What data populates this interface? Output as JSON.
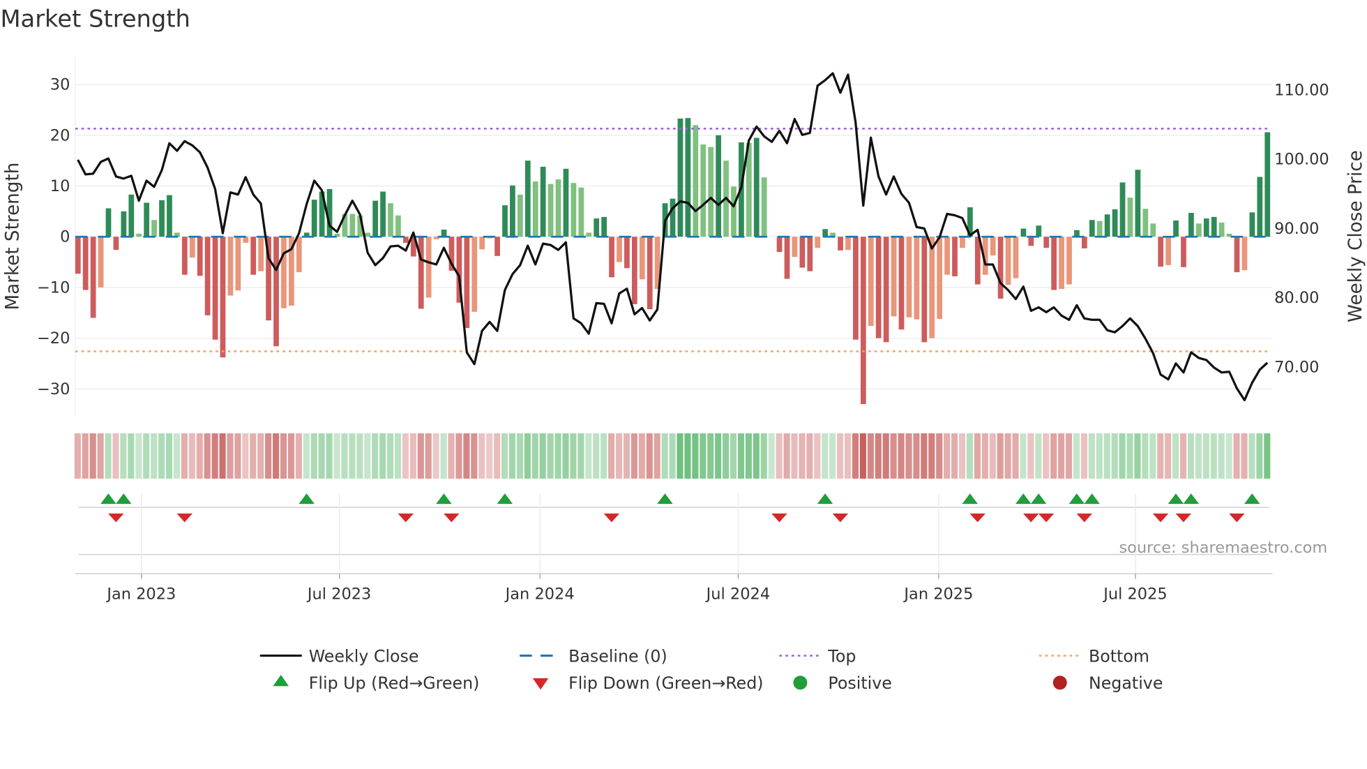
{
  "chart_data": {
    "type": "bar",
    "title": "Market Strength",
    "ylabel": "Market Strength",
    "y2label": "Weekly Close Price",
    "ylim": [
      -35.5,
      35.5
    ],
    "y2lim": [
      62.8,
      114.8
    ],
    "grid": true,
    "legend_placement": "bottom",
    "source": "source: sharemaestro.com",
    "y_ticks": [
      {
        "v": 30,
        "label": "30"
      },
      {
        "v": 20,
        "label": "20"
      },
      {
        "v": 10,
        "label": "10"
      },
      {
        "v": 0,
        "label": "0"
      },
      {
        "v": -10,
        "label": "−10"
      },
      {
        "v": -20,
        "label": "−20"
      },
      {
        "v": -30,
        "label": "−30"
      }
    ],
    "y2_ticks": [
      {
        "v": 110,
        "label": "110.00"
      },
      {
        "v": 100,
        "label": "100.00"
      },
      {
        "v": 90,
        "label": "90.00"
      },
      {
        "v": 80,
        "label": "80.00"
      },
      {
        "v": 70,
        "label": "70.00"
      }
    ],
    "x_ticks": [
      {
        "week": 8.34,
        "label": "Jan 2023"
      },
      {
        "week": 34.3,
        "label": "Jul 2023"
      },
      {
        "week": 60.6,
        "label": "Jan 2024"
      },
      {
        "week": 86.6,
        "label": "Jul 2024"
      },
      {
        "week": 112.9,
        "label": "Jan 2025"
      },
      {
        "week": 138.7,
        "label": "Jul 2025"
      }
    ],
    "top_level": 21.3,
    "bottom_level": -22.6,
    "strength": [
      -7.3,
      -10.5,
      -16,
      -10,
      5.6,
      -2.6,
      5,
      8.3,
      0.6,
      6.7,
      3.3,
      7.2,
      8.2,
      0.8,
      -7.5,
      -4.1,
      -7.7,
      -15.5,
      -20.3,
      -23.8,
      -11.6,
      -10.6,
      -1.2,
      -7.5,
      -6.8,
      -16.5,
      -21.6,
      -14.1,
      -13.6,
      -7,
      0.8,
      7.3,
      8.9,
      9.4,
      0.6,
      4.5,
      4.5,
      4.2,
      0.8,
      7.1,
      8.9,
      6.6,
      4.2,
      -1.2,
      -3.9,
      -14.2,
      -12,
      -0.5,
      1.4,
      -6.7,
      -13,
      -18,
      -14.8,
      -2.5,
      -0.3,
      -3.8,
      6.2,
      10.1,
      8.3,
      15,
      10.9,
      13.8,
      10.4,
      11.3,
      13.4,
      10.6,
      9.7,
      0.8,
      3.6,
      3.9,
      -8,
      -5,
      -6.2,
      -13.3,
      -8.4,
      -14.3,
      -10.3,
      6.6,
      7.5,
      23.3,
      23.4,
      22,
      18.2,
      17.7,
      20,
      15,
      9.9,
      18.6,
      18.5,
      19.5,
      11.7,
      0,
      -3,
      -8.3,
      -4,
      -6.1,
      -6.8,
      -2.2,
      1.5,
      0.8,
      -2.7,
      -2.6,
      -20.3,
      -33,
      -17.6,
      -20,
      -20.8,
      -15.7,
      -18.3,
      -15.9,
      -16.3,
      -20.8,
      -20,
      -16.2,
      -7.5,
      -7.8,
      -2.2,
      5.8,
      -9.4,
      -7.5,
      -3.7,
      -12.2,
      -9.5,
      -8.2,
      1.6,
      -1.8,
      2.2,
      -2.2,
      -10.5,
      -10.3,
      -9.4,
      1.3,
      -2.3,
      3.3,
      3.1,
      4.4,
      5.4,
      10.7,
      7.7,
      13.2,
      5.5,
      2.6,
      -5.9,
      -5.6,
      3.2,
      -6,
      4.7,
      2.6,
      3.6,
      3.9,
      2.8,
      0.6,
      -7,
      -6.6,
      4.8,
      11.8,
      20.6
    ],
    "strong": [
      1,
      1,
      1,
      0,
      1,
      1,
      1,
      1,
      0,
      1,
      0,
      1,
      1,
      0,
      1,
      0,
      1,
      1,
      1,
      1,
      0,
      0,
      0,
      1,
      0,
      1,
      1,
      0,
      0,
      0,
      1,
      1,
      1,
      1,
      0,
      0,
      0,
      0,
      0,
      1,
      1,
      0,
      0,
      1,
      1,
      1,
      0,
      0,
      1,
      1,
      1,
      1,
      0,
      0,
      0,
      1,
      1,
      1,
      0,
      1,
      0,
      1,
      0,
      0,
      1,
      0,
      0,
      0,
      1,
      1,
      1,
      0,
      1,
      1,
      0,
      1,
      0,
      1,
      1,
      1,
      1,
      0,
      0,
      0,
      1,
      0,
      0,
      1,
      0,
      1,
      0,
      0,
      1,
      1,
      0,
      1,
      1,
      0,
      1,
      0,
      1,
      0,
      1,
      1,
      0,
      1,
      1,
      0,
      1,
      0,
      0,
      1,
      0,
      0,
      0,
      1,
      0,
      1,
      1,
      0,
      0,
      1,
      0,
      0,
      1,
      1,
      1,
      1,
      1,
      0,
      0,
      1,
      1,
      1,
      0,
      1,
      1,
      1,
      0,
      1,
      0,
      0,
      1,
      0,
      1,
      1,
      1,
      0,
      1,
      1,
      0,
      0,
      1,
      0,
      1,
      1,
      1
    ],
    "weekly_close": [
      99.9,
      97.8,
      97.9,
      99.6,
      100.1,
      97.5,
      97.2,
      97.6,
      94,
      96.9,
      96,
      98.4,
      102.3,
      101.2,
      102.6,
      102,
      101,
      98.8,
      95.7,
      89.3,
      95.2,
      94.9,
      97.4,
      94.9,
      93.6,
      85.7,
      84,
      86.4,
      87,
      89.3,
      93.5,
      96.9,
      95.5,
      90.4,
      89.5,
      91.9,
      94,
      92,
      86.5,
      84.7,
      85.7,
      87.4,
      87.5,
      86.8,
      89.4,
      85.5,
      85.1,
      84.8,
      87.2,
      84.9,
      83.1,
      72.1,
      70.4,
      75.2,
      76.5,
      75.2,
      81.1,
      83.4,
      84.7,
      87.5,
      84.8,
      87.8,
      87.6,
      86.9,
      88,
      77,
      76.3,
      74.8,
      79.2,
      79.1,
      76.3,
      80.6,
      81.3,
      77.6,
      78.5,
      76.7,
      78.3,
      91.1,
      92.9,
      93.9,
      93.7,
      92.5,
      93.4,
      94.4,
      93.4,
      94.4,
      93.2,
      95.9,
      102.7,
      104.7,
      103.3,
      102.5,
      104.1,
      102.3,
      105.8,
      103.5,
      103.8,
      110.6,
      111.4,
      112.4,
      109.6,
      112.2,
      105.3,
      93.3,
      103.1,
      97.5,
      94.9,
      97.5,
      95,
      93.7,
      90.2,
      90,
      87.1,
      88.7,
      92.1,
      91.9,
      91.5,
      89,
      89.8,
      84.8,
      84.8,
      82.1,
      81.1,
      79.8,
      81.6,
      78.1,
      78.6,
      77.9,
      78.6,
      77.4,
      76.8,
      78.9,
      77,
      76.8,
      76.8,
      75.3,
      75,
      75.9,
      77,
      75.9,
      74.1,
      72,
      68.9,
      68.2,
      70.5,
      69.2,
      72.1,
      71.3,
      71,
      69.9,
      69.2,
      69.3,
      66.9,
      65.2,
      67.7,
      69.6,
      70.6
    ],
    "legend": {
      "weekly_close": "Weekly Close",
      "baseline": "Baseline (0)",
      "top": "Top",
      "bottom": "Bottom",
      "flip_up": "Flip Up (Red→Green)",
      "flip_down": "Flip Down (Green→Red)",
      "positive": "Positive",
      "negative": "Negative"
    },
    "colors": {
      "strong_pos": "#2e8b57",
      "weak_pos": "#80c080",
      "strong_neg": "#cd5c5c",
      "weak_neg": "#e9967a",
      "line": "#111111",
      "baseline": "#1f77b4",
      "top": "#9b5de5",
      "bottom": "#f4a460",
      "flip_up": "#1f9e3a",
      "flip_down": "#d62728",
      "positive": "#1f9e3a",
      "negative": "#b22222"
    }
  }
}
